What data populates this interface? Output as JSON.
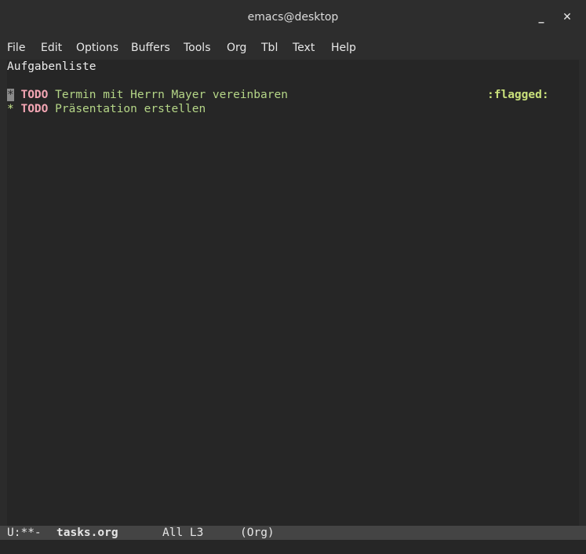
{
  "window": {
    "title": "emacs@desktop",
    "minimize_glyph": "_",
    "close_glyph": "✕"
  },
  "menubar": {
    "items": [
      "File",
      "Edit",
      "Options",
      "Buffers",
      "Tools",
      "Org",
      "Tbl",
      "Text",
      "Help"
    ]
  },
  "buffer": {
    "title_line": "Aufgabenliste",
    "headings": [
      {
        "star": "*",
        "keyword": "TODO",
        "text": "Termin mit Herrn Mayer vereinbaren",
        "tag": ":flagged:",
        "has_cursor": true
      },
      {
        "star": "*",
        "keyword": "TODO",
        "text": "Präsentation erstellen",
        "tag": "",
        "has_cursor": false
      }
    ]
  },
  "modeline": {
    "state": "U:**-",
    "buffer_name": "tasks.org",
    "position": "All L3",
    "mode": "(Org)"
  },
  "colors": {
    "background": "#262626",
    "todo_keyword": "#f4a6b4",
    "heading_text": "#b5d687",
    "tag": "#c8e07a",
    "modeline_bg": "#444444"
  }
}
